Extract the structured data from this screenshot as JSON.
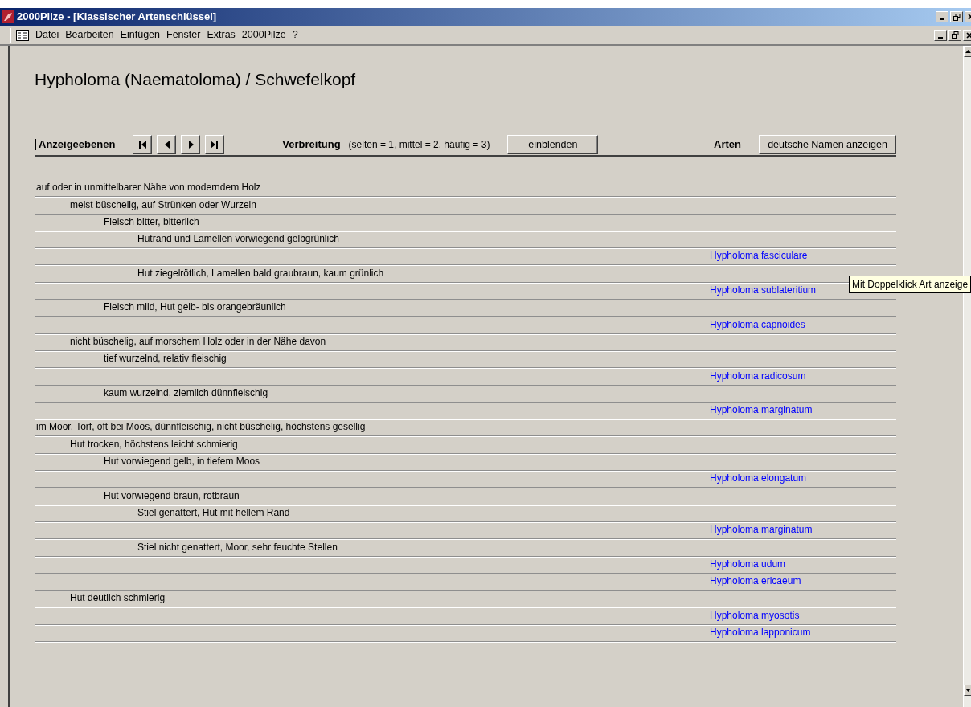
{
  "window": {
    "title": "2000Pilze - [Klassischer Artenschlüssel]"
  },
  "menu": [
    "Datei",
    "Bearbeiten",
    "Einfügen",
    "Fenster",
    "Extras",
    "2000Pilze",
    "?"
  ],
  "heading": "Hypholoma (Naematoloma) / Schwefelkopf",
  "toolbar": {
    "levels_label": "Anzeigeebenen",
    "distribution_label": "Verbreitung",
    "distribution_hint": "(selten = 1, mittel = 2, häufig = 3)",
    "show_button": "einblenden",
    "species_label": "Arten",
    "names_button": "deutsche Namen anzeigen"
  },
  "key": [
    {
      "kind": "step",
      "text": "auf oder in unmittelbarer Nähe von moderndem Holz",
      "children": [
        {
          "kind": "step",
          "text": "meist büschelig, auf Strünken oder Wurzeln",
          "children": [
            {
              "kind": "step",
              "text": "Fleisch bitter, bitterlich",
              "children": [
                {
                  "kind": "step",
                  "text": "Hutrand und Lamellen vorwiegend gelbgrünlich",
                  "children": [
                    {
                      "kind": "species",
                      "text": "Hypholoma fasciculare"
                    }
                  ]
                },
                {
                  "kind": "step",
                  "text": "Hut ziegelrötlich, Lamellen bald graubraun, kaum grünlich",
                  "children": [
                    {
                      "kind": "species",
                      "text": "Hypholoma sublateritium"
                    }
                  ]
                }
              ]
            },
            {
              "kind": "step",
              "text": "Fleisch mild, Hut gelb- bis orangebräunlich",
              "children": [
                {
                  "kind": "species",
                  "text": "Hypholoma capnoides"
                }
              ]
            }
          ]
        },
        {
          "kind": "step",
          "text": "nicht büschelig, auf morschem Holz oder in der Nähe davon",
          "children": [
            {
              "kind": "step",
              "text": "tief wurzelnd, relativ fleischig",
              "children": [
                {
                  "kind": "species",
                  "text": "Hypholoma radicosum"
                }
              ]
            },
            {
              "kind": "step",
              "text": "kaum wurzelnd, ziemlich dünnfleischig",
              "children": [
                {
                  "kind": "species",
                  "text": "Hypholoma marginatum"
                }
              ]
            }
          ]
        }
      ]
    },
    {
      "kind": "step",
      "text": "im Moor, Torf, oft bei Moos, dünnfleischig, nicht büschelig, höchstens gesellig",
      "children": [
        {
          "kind": "step",
          "text": "Hut trocken, höchstens leicht schmierig",
          "children": [
            {
              "kind": "step",
              "text": "Hut vorwiegend gelb, in tiefem Moos",
              "children": [
                {
                  "kind": "species",
                  "text": "Hypholoma elongatum"
                }
              ]
            },
            {
              "kind": "step",
              "text": "Hut vorwiegend braun, rotbraun",
              "children": [
                {
                  "kind": "step",
                  "text": "Stiel genattert, Hut mit hellem Rand",
                  "children": [
                    {
                      "kind": "species",
                      "text": "Hypholoma marginatum"
                    }
                  ]
                },
                {
                  "kind": "step",
                  "text": "Stiel nicht genattert, Moor, sehr feuchte Stellen",
                  "children": [
                    {
                      "kind": "species",
                      "text": "Hypholoma udum"
                    },
                    {
                      "kind": "species",
                      "text": "Hypholoma ericaeum"
                    }
                  ]
                }
              ]
            }
          ]
        },
        {
          "kind": "step",
          "text": "Hut deutlich schmierig",
          "children": [
            {
              "kind": "species",
              "text": "Hypholoma myosotis"
            },
            {
              "kind": "species",
              "text": "Hypholoma lapponicum"
            }
          ]
        }
      ]
    }
  ],
  "tooltip": "Mit Doppelklick Art anzeige"
}
